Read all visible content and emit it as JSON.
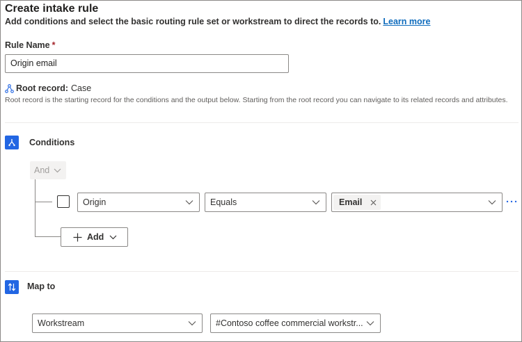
{
  "header": {
    "title": "Create intake rule",
    "subtitle": "Add conditions and select the basic routing rule set or workstream to direct the records to.",
    "learn_more": "Learn more"
  },
  "rule_name": {
    "label": "Rule Name",
    "required_marker": "*",
    "value": "Origin email"
  },
  "root_record": {
    "label": "Root record:",
    "value": "Case",
    "description": "Root record is the starting record for the conditions and the output below. Starting from the root record you can navigate to its related records and attributes."
  },
  "conditions": {
    "title": "Conditions",
    "group_operator": "And",
    "row": {
      "field": "Origin",
      "operator": "Equals",
      "value_tag": "Email"
    },
    "add_label": "Add"
  },
  "map_to": {
    "title": "Map to",
    "type": "Workstream",
    "target": "#Contoso coffee commercial workstr..."
  },
  "colors": {
    "accent": "#2266e3",
    "link": "#0f6cbd",
    "required": "#a4262c",
    "border": "#8a8886"
  },
  "icons": {
    "root_record": "hierarchy-icon",
    "conditions": "branch-icon",
    "map_to": "swap-arrows-icon",
    "dropdown": "chevron-down-icon",
    "remove_tag": "close-icon",
    "more": "more-icon",
    "add": "plus-icon"
  }
}
